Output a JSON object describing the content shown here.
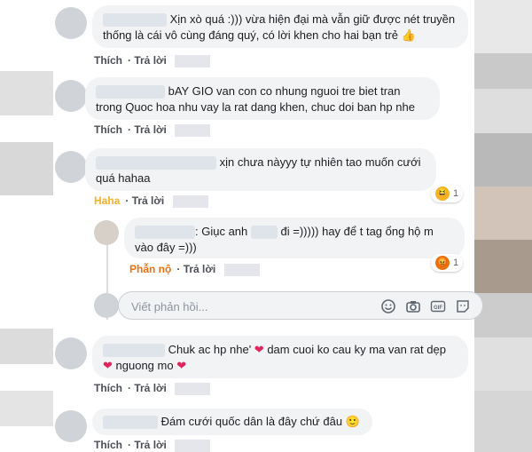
{
  "comments": [
    {
      "text": "Xịn xò quá :))) vừa hiện đại mà vẫn giữ được nét truyền thống là cái vô cùng đáng quý, có lời khen cho hai bạn trẻ",
      "like": "Thích",
      "reply": "Trả lời"
    },
    {
      "text": "bAY GIO van con co nhung nguoi tre biet tran trong Quoc hoa nhu vay la rat dang khen, chuc doi ban hp nhe",
      "like": "Thích",
      "reply": "Trả lời"
    },
    {
      "text": "xịn chưa nàyyy tự nhiên tao muốn cưới quá hahaa",
      "reaction_label": "Haha",
      "reply": "Trả lời",
      "count": "1"
    },
    {
      "text_a": ": Giục anh",
      "text_b": "đi =))))) hay để t tag ổng hộ m vào đây =)))",
      "reaction_label": "Phẫn nộ",
      "reply": "Trả lời",
      "count": "1"
    },
    {
      "text_a": "Chuk ac hp nhe'",
      "text_b": "dam cuoi ko cau ky ma van rat dẹp",
      "text_c": "nguong mo",
      "like": "Thích",
      "reply": "Trả lời"
    },
    {
      "text": "Đám cưới quốc dân là đây chứ đâu",
      "like": "Thích",
      "reply": "Trả lời"
    }
  ],
  "reply_box": {
    "placeholder": "Viết phản hồi..."
  },
  "colors": {
    "haha": "#f7b125",
    "angry": "#e9710f",
    "heart": "#e0245e",
    "link": "#4b4f56"
  },
  "icons": [
    "thumbs-up-icon",
    "heart-icon",
    "haha-icon",
    "angry-icon",
    "smile-icon",
    "camera-icon",
    "gif-icon",
    "sticker-icon"
  ]
}
